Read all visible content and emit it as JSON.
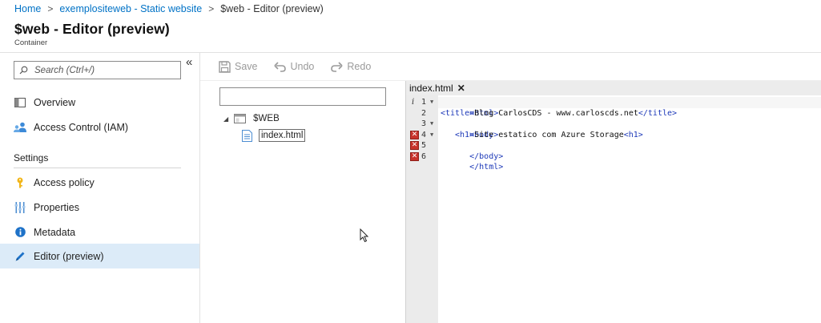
{
  "breadcrumb": {
    "items": [
      "Home",
      "exemplositeweb - Static website"
    ],
    "current": "$web - Editor (preview)"
  },
  "header": {
    "title": "$web - Editor (preview)",
    "subtitle": "Container"
  },
  "sidebar": {
    "collapse_glyph": "«",
    "search_placeholder": "Search (Ctrl+/)",
    "items": [
      {
        "label": "Overview",
        "icon": "overview-icon"
      },
      {
        "label": "Access Control (IAM)",
        "icon": "iam-icon"
      }
    ],
    "section_label": "Settings",
    "settings_items": [
      {
        "label": "Access policy",
        "icon": "key-icon"
      },
      {
        "label": "Properties",
        "icon": "properties-icon"
      },
      {
        "label": "Metadata",
        "icon": "info-icon"
      },
      {
        "label": "Editor (preview)",
        "icon": "pencil-icon",
        "active": true
      }
    ]
  },
  "toolbar": {
    "save_label": "Save",
    "undo_label": "Undo",
    "redo_label": "Redo"
  },
  "tree": {
    "filter_value": "",
    "root_label": "$WEB",
    "file_label": "index.html"
  },
  "editor": {
    "tab_label": "index.html",
    "tab_close": "✕",
    "lines": [
      {
        "num": "1",
        "marker": "i",
        "fold": true
      },
      {
        "num": "2",
        "marker": "",
        "fold": false
      },
      {
        "num": "3",
        "marker": "",
        "fold": true
      },
      {
        "num": "4",
        "marker": "error",
        "fold": true
      },
      {
        "num": "5",
        "marker": "error",
        "fold": false
      },
      {
        "num": "6",
        "marker": "error",
        "fold": false
      }
    ],
    "code": {
      "l1_tag": "<html>",
      "l2_open": "<title>",
      "l2_text": "Blog CarlosCDS - www.carloscds.net",
      "l2_close": "</title>",
      "l3_tag": "<body>",
      "l4_open": "<h1>",
      "l4_text": "Site estatico com Azure Storage",
      "l4_close": "<h1>",
      "l5_tag": "</body>",
      "l6_tag": "</html>"
    }
  },
  "colors": {
    "accent": "#0072c6",
    "active_nav_bg": "#dcebf8",
    "code_tag": "#1c38b8",
    "error_marker": "#c8332b"
  }
}
